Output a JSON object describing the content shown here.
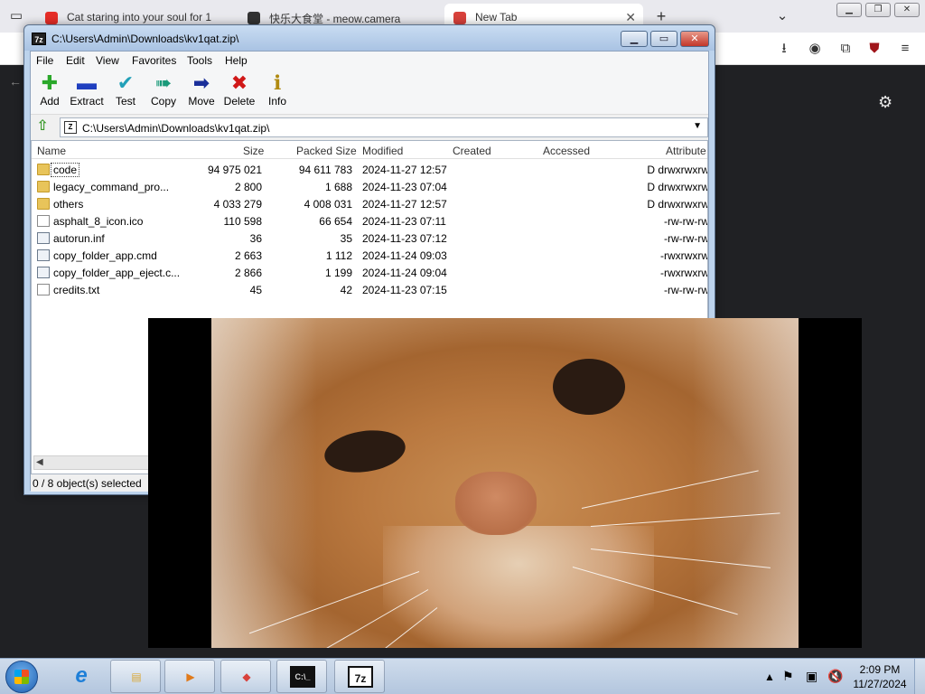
{
  "browser": {
    "tabs": [
      {
        "title": "Cat staring into your soul for 1",
        "favicon": "youtube-icon",
        "color": "#e52d27"
      },
      {
        "title": "快乐大食堂 - meow.camera",
        "favicon": "cat-icon",
        "color": "#333333"
      },
      {
        "title": "New Tab",
        "favicon": "browser-logo-icon",
        "color": "#d8413b"
      }
    ],
    "new_tab_symbol": "+",
    "close_symbol": "✕"
  },
  "zip_window": {
    "title": "C:\\Users\\Admin\\Downloads\\kv1qat.zip\\",
    "app_icon_text": "7z",
    "menu": [
      "File",
      "Edit",
      "View",
      "Favorites",
      "Tools",
      "Help"
    ],
    "toolbar": [
      {
        "label": "Add",
        "icon": "plus-icon",
        "color": "#2aa82a"
      },
      {
        "label": "Extract",
        "icon": "minus-icon",
        "color": "#1f3fbf"
      },
      {
        "label": "Test",
        "icon": "checkmark-icon",
        "color": "#22a0b8"
      },
      {
        "label": "Copy",
        "icon": "double-arrow-icon",
        "color": "#1a9a7a"
      },
      {
        "label": "Move",
        "icon": "arrow-right-icon",
        "color": "#1a2f9a"
      },
      {
        "label": "Delete",
        "icon": "x-icon",
        "color": "#d01818"
      },
      {
        "label": "Info",
        "icon": "info-icon",
        "color": "#b08a10"
      }
    ],
    "address": "C:\\Users\\Admin\\Downloads\\kv1qat.zip\\",
    "columns": [
      "Name",
      "Size",
      "Packed Size",
      "Modified",
      "Created",
      "Accessed",
      "Attribute"
    ],
    "files": [
      {
        "name": "code",
        "type": "folder",
        "size": "94 975 021",
        "packed": "94 611 783",
        "modified": "2024-11-27 12:57",
        "attr": "D drwxrwxrw"
      },
      {
        "name": "legacy_command_pro...",
        "type": "folder",
        "size": "2 800",
        "packed": "1 688",
        "modified": "2024-11-23 07:04",
        "attr": "D drwxrwxrw"
      },
      {
        "name": "others",
        "type": "folder",
        "size": "4 033 279",
        "packed": "4 008 031",
        "modified": "2024-11-27 12:57",
        "attr": "D drwxrwxrw"
      },
      {
        "name": "asphalt_8_icon.ico",
        "type": "file",
        "size": "110 598",
        "packed": "66 654",
        "modified": "2024-11-23 07:11",
        "attr": "-rw-rw-rw"
      },
      {
        "name": "autorun.inf",
        "type": "cfg",
        "size": "36",
        "packed": "35",
        "modified": "2024-11-23 07:12",
        "attr": "-rw-rw-rw"
      },
      {
        "name": "copy_folder_app.cmd",
        "type": "cfg",
        "size": "2 663",
        "packed": "1 112",
        "modified": "2024-11-24 09:03",
        "attr": "-rwxrwxrw"
      },
      {
        "name": "copy_folder_app_eject.c...",
        "type": "cfg",
        "size": "2 866",
        "packed": "1 199",
        "modified": "2024-11-24 09:04",
        "attr": "-rwxrwxrw"
      },
      {
        "name": "credits.txt",
        "type": "file",
        "size": "45",
        "packed": "42",
        "modified": "2024-11-23 07:15",
        "attr": "-rw-rw-rw"
      }
    ],
    "status": "0 / 8 object(s) selected"
  },
  "taskbar": {
    "apps": [
      {
        "name": "internet-explorer-icon",
        "glyph": "e",
        "color": "#1e7fd8"
      },
      {
        "name": "file-explorer-icon",
        "glyph": "▤",
        "color": "#d9a93a"
      },
      {
        "name": "media-player-icon",
        "glyph": "▶",
        "color": "#e07a1a"
      },
      {
        "name": "browser-logo-icon",
        "glyph": "◆",
        "color": "#d8413b"
      },
      {
        "name": "command-prompt-icon",
        "glyph": "C:\\_",
        "color": "#111111"
      },
      {
        "name": "7zip-icon",
        "glyph": "7z",
        "color": "#111111"
      }
    ],
    "time": "2:09 PM",
    "date": "11/27/2024"
  }
}
